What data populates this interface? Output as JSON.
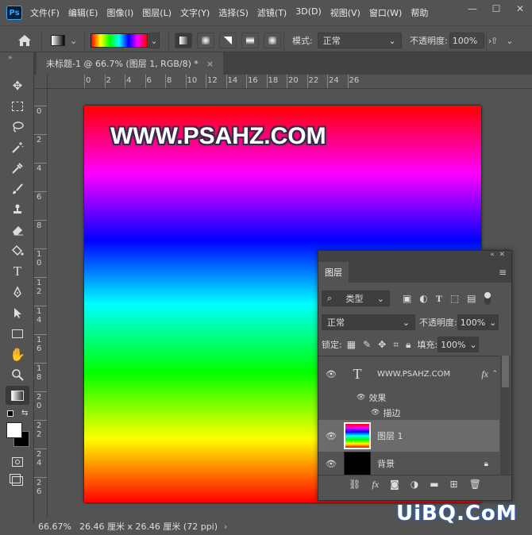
{
  "app": {
    "logo": "Ps"
  },
  "menu": [
    "文件(F)",
    "编辑(E)",
    "图像(I)",
    "图层(L)",
    "文字(Y)",
    "选择(S)",
    "滤镜(T)",
    "3D(D)",
    "视图(V)",
    "窗口(W)",
    "帮助"
  ],
  "window_controls": [
    "—",
    "☐",
    "✕"
  ],
  "options": {
    "mode_label": "模式:",
    "mode_value": "正常",
    "opacity_label": "不透明度:",
    "opacity_value": "100%"
  },
  "document_tab": {
    "title": "未标题-1 @ 66.7% (图层 1, RGB/8) *",
    "close": "×"
  },
  "ruler_h_labels": [
    "0",
    "2",
    "4",
    "6",
    "8",
    "10",
    "12",
    "14",
    "16",
    "18",
    "20",
    "22",
    "24",
    "26"
  ],
  "ruler_v_labels": [
    "0",
    "2",
    "4",
    "6",
    "8",
    "1\n0",
    "1\n2",
    "1\n4",
    "1\n6",
    "1\n8",
    "2\n0",
    "2\n2",
    "2\n4",
    "2\n6"
  ],
  "canvas": {
    "text": "WWW.PSAHZ.COM"
  },
  "status": {
    "zoom": "66.67%",
    "info": "26.46 厘米 x 26.46 厘米 (72 ppi)",
    "arrow": "›"
  },
  "layers_panel": {
    "tab": "图层",
    "filter_kind": "类型",
    "blend": "正常",
    "opacity_label": "不透明度:",
    "opacity_value": "100%",
    "lock_label": "锁定:",
    "fill_label": "填充:",
    "fill_value": "100%",
    "layers": [
      {
        "name": "WWW.PSAHZ.COM",
        "type": "text",
        "fx": "fx"
      },
      {
        "name": "效果",
        "type": "effect-group"
      },
      {
        "name": "描边",
        "type": "effect"
      },
      {
        "name": "图层 1",
        "type": "pixel",
        "selected": true
      },
      {
        "name": "背景",
        "type": "background",
        "locked": true
      }
    ]
  },
  "watermark": "UiBQ.CoM"
}
